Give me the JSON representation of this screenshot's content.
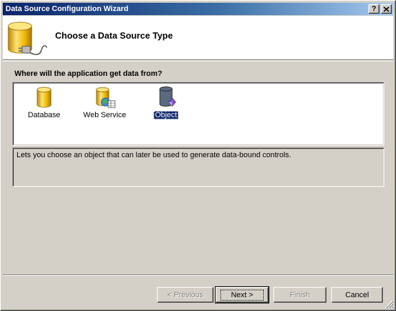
{
  "window": {
    "title": "Data Source Configuration Wizard",
    "help_button": "?",
    "close_button": "X"
  },
  "header": {
    "title": "Choose a Data Source Type",
    "icon": "database-plug-icon"
  },
  "question": "Where will the application get data from?",
  "types": [
    {
      "label": "Database",
      "icon": "database-icon",
      "selected": false
    },
    {
      "label": "Web Service",
      "icon": "web-service-icon",
      "selected": false
    },
    {
      "label": "Object",
      "icon": "object-icon",
      "selected": true
    }
  ],
  "description": "Lets you choose an object that can later be used to generate data-bound controls.",
  "buttons": {
    "previous": "< Previous",
    "next": "Next >",
    "finish": "Finish",
    "cancel": "Cancel"
  },
  "colors": {
    "title_bar_start": "#0a246a",
    "title_bar_end": "#a6caf0",
    "selection": "#0a246a",
    "dialog_face": "#d4d0c8",
    "database_gold": "#e8b000"
  }
}
